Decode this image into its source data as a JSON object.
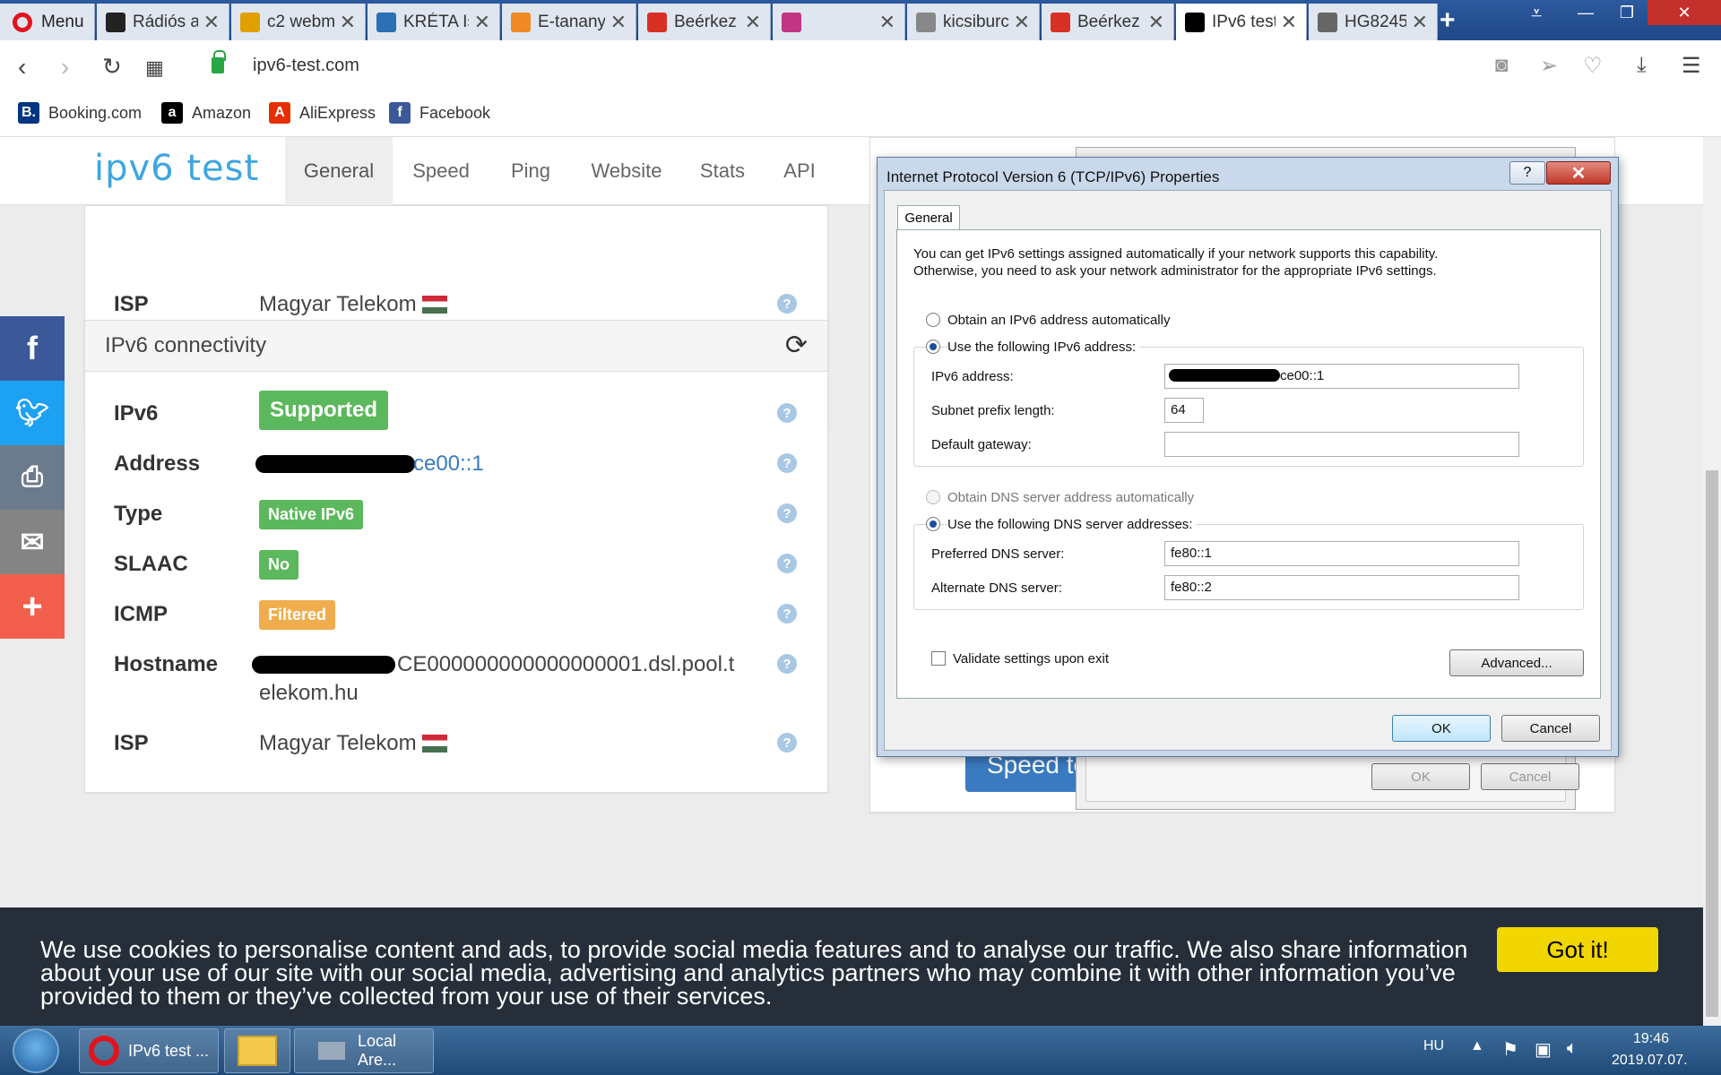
{
  "browser": {
    "menu_label": "Menu",
    "tabs": [
      {
        "label": "Rádiós a",
        "icon_color": "#222"
      },
      {
        "label": "c2 webm",
        "icon_color": "#e0a000"
      },
      {
        "label": "KRÉTA Is",
        "icon_color": "#2b6fb5"
      },
      {
        "label": "E-tanany",
        "icon_color": "#f08a24"
      },
      {
        "label": "Beérkez",
        "icon_color": "#d93025"
      },
      {
        "label": "",
        "icon_color": "#c13584"
      },
      {
        "label": "kicsiburc",
        "icon_color": "#888"
      },
      {
        "label": "Beérkez",
        "icon_color": "#d93025"
      },
      {
        "label": "IPv6 test",
        "icon_color": "#000"
      },
      {
        "label": "HG8245",
        "icon_color": "#666"
      }
    ],
    "url": "ipv6-test.com",
    "bookmarks": [
      {
        "label": "Booking.com",
        "icon_color": "#003580",
        "glyph": "B."
      },
      {
        "label": "Amazon",
        "icon_color": "#000",
        "glyph": "a"
      },
      {
        "label": "AliExpress",
        "icon_color": "#e62e04",
        "glyph": "A"
      },
      {
        "label": "Facebook",
        "icon_color": "#3b5998",
        "glyph": "f"
      }
    ]
  },
  "site": {
    "logo": "ipv6 test",
    "nav": [
      "General",
      "Speed",
      "Ping",
      "Website",
      "Stats",
      "API"
    ],
    "top_card": {
      "isp_key": "ISP",
      "isp_value": "Magyar Telekom"
    },
    "connectivity": {
      "title": "IPv6 connectivity",
      "rows": {
        "ipv6": {
          "key": "IPv6",
          "value": "Supported",
          "color": "#5cb85c"
        },
        "address": {
          "key": "Address",
          "value": "ce00::1"
        },
        "type": {
          "key": "Type",
          "value": "Native IPv6",
          "color": "#5cb85c"
        },
        "slaac": {
          "key": "SLAAC",
          "value": "No",
          "color": "#5cb85c"
        },
        "icmp": {
          "key": "ICMP",
          "value": "Filtered",
          "color": "#f0ad4e"
        },
        "hostname": {
          "key": "Hostname",
          "value_line1": "CE000000000000000001.dsl.pool.t",
          "value_line2": "elekom.hu"
        },
        "isp": {
          "key": "ISP",
          "value": "Magyar Telekom"
        }
      }
    },
    "speed_button": "Speed tes",
    "help_glyph": "?"
  },
  "dialog": {
    "title": "Internet Protocol Version 6 (TCP/IPv6) Properties",
    "help": "?",
    "tab": "General",
    "intro_line1": "You can get IPv6 settings assigned automatically if your network supports this capability.",
    "intro_line2": "Otherwise, you need to ask your network administrator for the appropriate IPv6 settings.",
    "radio_auto": "Obtain an IPv6 address automatically",
    "radio_manual": "Use the following IPv6 address:",
    "ipv6_label": "IPv6 address:",
    "ipv6_value": "ce00::1",
    "prefix_label": "Subnet prefix length:",
    "prefix_value": "64",
    "gateway_label": "Default gateway:",
    "gateway_value": "",
    "dns_auto": "Obtain DNS server address automatically",
    "dns_manual": "Use the following DNS server addresses:",
    "pref_dns_label": "Preferred DNS server:",
    "pref_dns_value": "fe80::1",
    "alt_dns_label": "Alternate DNS server:",
    "alt_dns_value": "fe80::2",
    "validate_label": "Validate settings upon exit",
    "advanced": "Advanced...",
    "ok": "OK",
    "cancel": "Cancel"
  },
  "bg_dialog": {
    "ok": "OK",
    "cancel": "Cancel"
  },
  "cookie": {
    "text": "We use cookies to personalise content and ads, to provide social media features and to analyse our traffic. We also share information about your use of our site with our social media, advertising and analytics partners who may combine it with other information you’ve provided to them or they’ve collected from your use of their services.",
    "button": "Got it!"
  },
  "taskbar": {
    "items": [
      "IPv6 test ...",
      "",
      "Local Are..."
    ],
    "lang": "HU",
    "time": "19:46",
    "date": "2019.07.07."
  }
}
